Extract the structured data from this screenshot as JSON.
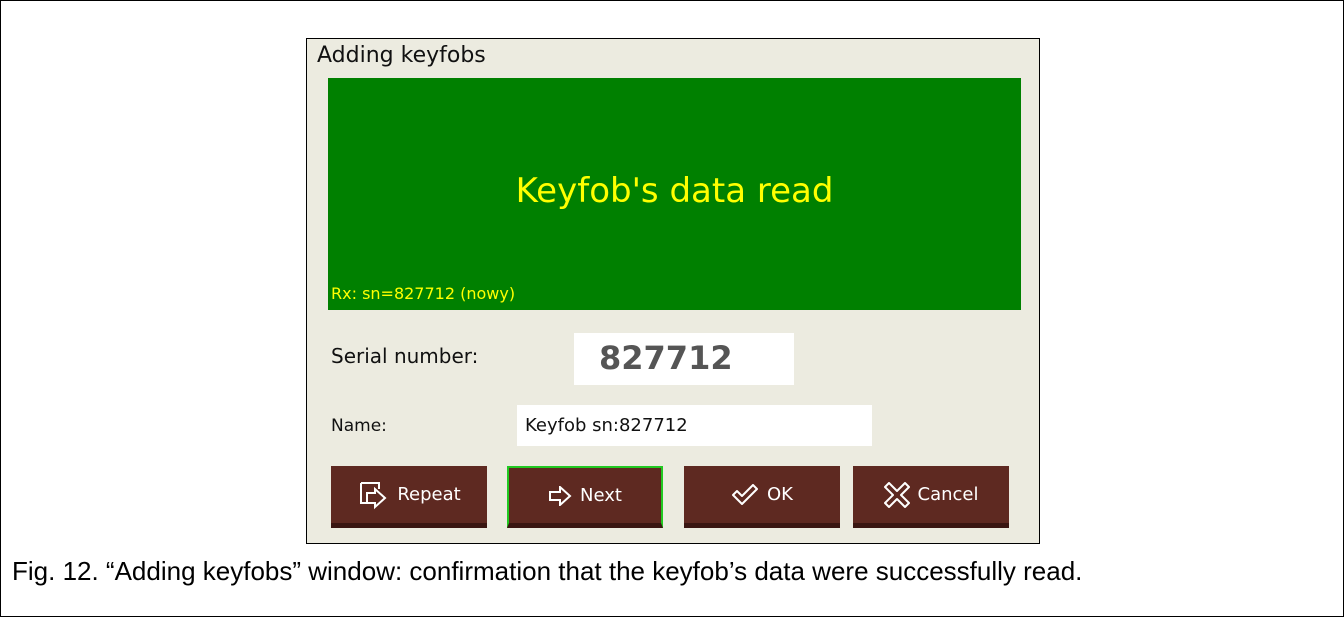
{
  "window": {
    "title": "Adding keyfobs",
    "status": {
      "message": "Keyfob's data read",
      "rx_line": "Rx: sn=827712 (nowy)",
      "background_color": "#008000",
      "text_color": "#ffff00"
    },
    "serial_label": "Serial number:",
    "serial_value": "827712",
    "name_label": "Name:",
    "name_value": "Keyfob sn:827712",
    "buttons": {
      "repeat": {
        "label": "Repeat",
        "icon": "repeat-icon"
      },
      "next": {
        "label": "Next",
        "icon": "arrow-right-icon"
      },
      "ok": {
        "label": "OK",
        "icon": "check-icon"
      },
      "cancel": {
        "label": "Cancel",
        "icon": "cancel-x-icon"
      }
    },
    "button_color": "#5e2921",
    "focus_color": "#22c922"
  },
  "caption": "Fig. 12. “Adding keyfobs” window: confirmation that the keyfob’s data were successfully read."
}
